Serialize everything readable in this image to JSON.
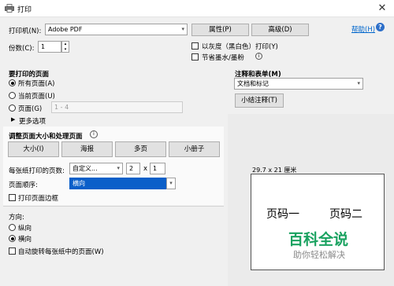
{
  "window": {
    "title": "打印",
    "close_glyph": "✕"
  },
  "printer": {
    "label": "打印机(N):",
    "selected": "Adobe PDF",
    "properties_btn": "属性(P)",
    "advanced_btn": "高级(D)",
    "help_link": "帮助(H)"
  },
  "copies": {
    "label": "份数(C):",
    "value": "1",
    "grayscale_label": "以灰度（黑白色）打印(Y)",
    "save_ink_label": "节省墨水/墨粉"
  },
  "pages_to_print": {
    "heading": "要打印的页面",
    "all_label": "所有页面(A)",
    "current_label": "当前页面(U)",
    "pages_label": "页面(G)",
    "pages_value": "1 - 4",
    "more_options": "更多选项"
  },
  "sizing": {
    "heading": "调整页面大小和处理页面",
    "buttons": [
      "大小(I)",
      "海报",
      "多页",
      "小册子"
    ],
    "pages_per_sheet_label": "每张纸打印的页数:",
    "custom_value": "自定义...",
    "cols": "2",
    "x": "x",
    "rows": "1",
    "page_order_label": "页面顺序:",
    "page_order_value": "横向",
    "print_border_label": "打印页面边框"
  },
  "orientation": {
    "heading": "方向:",
    "portrait": "纵向",
    "landscape": "横向",
    "auto_rotate": "自动旋转每张纸中的页面(W)"
  },
  "comments": {
    "heading": "注释和表单(M)",
    "selected": "文档和标记",
    "summarize_btn": "小结注释(T)"
  },
  "preview": {
    "size_text": "29.7 x 21 厘米",
    "page1": "页码一",
    "page2": "页码二",
    "watermark_main": "百科全说",
    "watermark_sub": "助你轻松解决"
  }
}
